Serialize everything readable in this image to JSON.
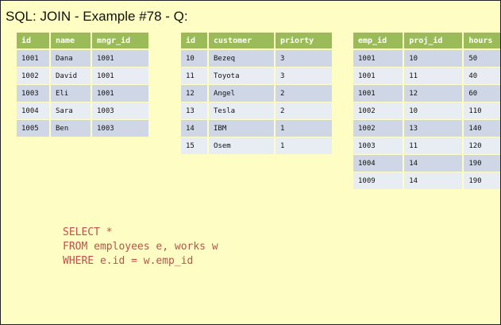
{
  "title": "SQL: JOIN - Example #78 - Q:",
  "employees": {
    "headers": [
      "id",
      "name",
      "mngr_id"
    ],
    "rows": [
      [
        "1001",
        "Dana",
        "1001"
      ],
      [
        "1002",
        "David",
        "1001"
      ],
      [
        "1003",
        "Eli",
        "1001"
      ],
      [
        "1004",
        "Sara",
        "1003"
      ],
      [
        "1005",
        "Ben",
        "1003"
      ]
    ]
  },
  "projects": {
    "headers": [
      "id",
      "customer",
      "priorty"
    ],
    "rows": [
      [
        "10",
        "Bezeq",
        "3"
      ],
      [
        "11",
        "Toyota",
        "3"
      ],
      [
        "12",
        "Angel",
        "2"
      ],
      [
        "13",
        "Tesla",
        "2"
      ],
      [
        "14",
        "IBM",
        "1"
      ],
      [
        "15",
        "Osem",
        "1"
      ]
    ]
  },
  "works": {
    "headers": [
      "emp_id",
      "proj_id",
      "hours"
    ],
    "rows": [
      [
        "1001",
        "10",
        "50"
      ],
      [
        "1001",
        "11",
        "40"
      ],
      [
        "1001",
        "12",
        "60"
      ],
      [
        "1002",
        "10",
        "110"
      ],
      [
        "1002",
        "13",
        "140"
      ],
      [
        "1003",
        "11",
        "120"
      ],
      [
        "1004",
        "14",
        "190"
      ],
      [
        "1009",
        "14",
        "190"
      ]
    ]
  },
  "sql": {
    "line1": "SELECT *",
    "line2": "FROM employees e, works w",
    "line3": "WHERE e.id = w.emp_id"
  }
}
